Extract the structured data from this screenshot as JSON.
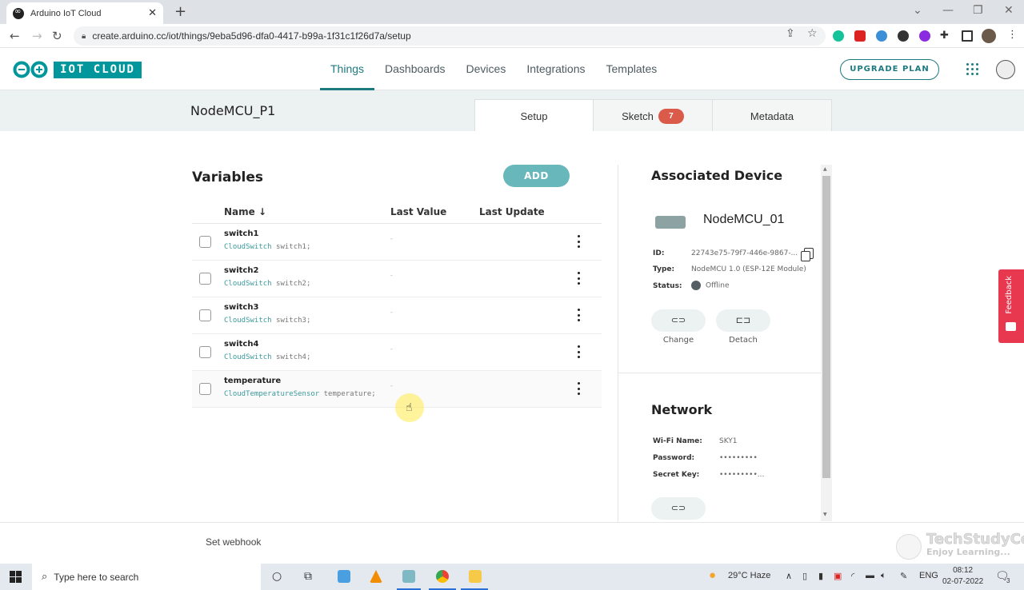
{
  "browser": {
    "tab_title": "Arduino IoT Cloud",
    "url": "create.arduino.cc/iot/things/9eba5d96-dfa0-4417-b99a-1f31c1f26d7a/setup",
    "icons": [
      "back-icon",
      "forward-icon",
      "reload-icon",
      "lock-icon",
      "share-icon",
      "star-icon",
      "grammarly-extension-icon",
      "flash-extension-icon",
      "globe-extension-icon",
      "k-extension-icon",
      "w-extension-icon",
      "puzzle-extensions-icon",
      "sidepanel-icon",
      "profile-avatar",
      "menu-kebab-icon"
    ]
  },
  "app": {
    "logo_text": "IOT CLOUD",
    "nav": [
      {
        "label": "Things",
        "active": true
      },
      {
        "label": "Dashboards",
        "active": false
      },
      {
        "label": "Devices",
        "active": false
      },
      {
        "label": "Integrations",
        "active": false
      },
      {
        "label": "Templates",
        "active": false
      }
    ],
    "upgrade_label": "UPGRADE PLAN",
    "accent_color": "#1d7a80",
    "brand_color": "#00979c"
  },
  "thing": {
    "name": "NodeMCU_P1",
    "tabs": [
      {
        "label": "Setup",
        "active": true
      },
      {
        "label": "Sketch",
        "badge": "7",
        "active": false
      },
      {
        "label": "Metadata",
        "active": false
      }
    ]
  },
  "variables": {
    "title": "Variables",
    "add_label": "ADD",
    "columns": {
      "name": "Name",
      "sort_icon": "↓",
      "last_value": "Last Value",
      "last_update": "Last Update"
    },
    "rows": [
      {
        "name": "switch1",
        "type": "CloudSwitch",
        "decl": "switch1;",
        "last_value": "-",
        "last_update": ""
      },
      {
        "name": "switch2",
        "type": "CloudSwitch",
        "decl": "switch2;",
        "last_value": "-",
        "last_update": ""
      },
      {
        "name": "switch3",
        "type": "CloudSwitch",
        "decl": "switch3;",
        "last_value": "-",
        "last_update": ""
      },
      {
        "name": "switch4",
        "type": "CloudSwitch",
        "decl": "switch4;",
        "last_value": "-",
        "last_update": ""
      },
      {
        "name": "temperature",
        "type": "CloudTemperatureSensor",
        "decl": "temperature;",
        "last_value": "-",
        "last_update": ""
      }
    ]
  },
  "device": {
    "title": "Associated Device",
    "name": "NodeMCU_01",
    "id_label": "ID:",
    "id_value": "22743e75-79f7-446e-9867-...",
    "type_label": "Type:",
    "type_value": "NodeMCU 1.0 (ESP-12E Module)",
    "status_label": "Status:",
    "status_value": "Offline",
    "change_label": "Change",
    "detach_label": "Detach"
  },
  "network": {
    "title": "Network",
    "wifi_label": "Wi-Fi Name:",
    "wifi_value": "SKY1",
    "password_label": "Password:",
    "password_value": "•••••••••",
    "secret_label": "Secret Key:",
    "secret_value": "•••••••••..."
  },
  "feedback_label": "Feedback",
  "bottom": {
    "webhook_label": "Set webhook",
    "watermark_title": "TechStudyCell",
    "watermark_sub": "Enjoy Learning..."
  },
  "taskbar": {
    "search_placeholder": "Type here to search",
    "weather": "29°C  Haze",
    "language": "ENG",
    "time": "08:12",
    "date": "02-07-2022",
    "notifications": "3"
  }
}
